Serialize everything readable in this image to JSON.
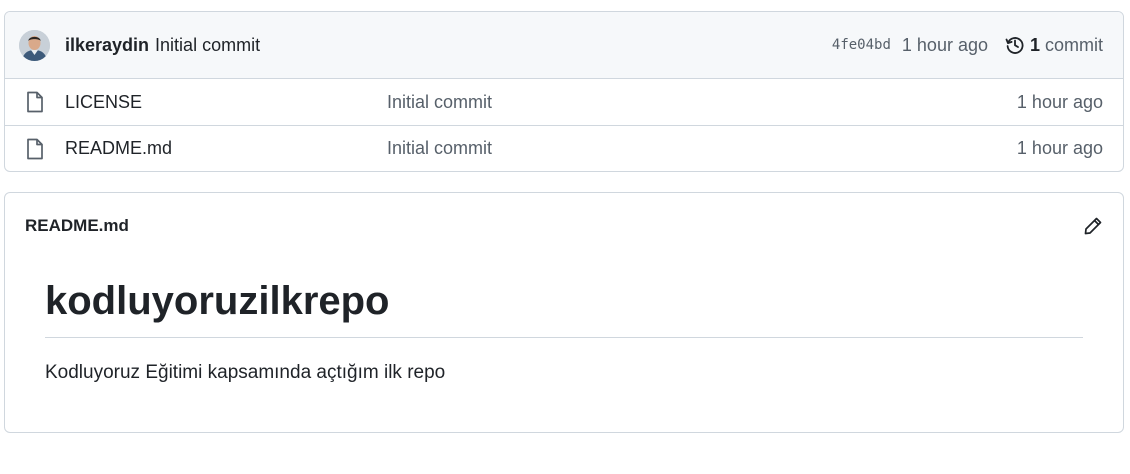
{
  "latest_commit": {
    "author": "ilkeraydin",
    "message": "Initial commit",
    "sha": "4fe04bd",
    "time": "1 hour ago",
    "commit_count": "1",
    "commit_word": "commit"
  },
  "files": [
    {
      "name": "LICENSE",
      "message": "Initial commit",
      "time": "1 hour ago",
      "icon": "file-icon"
    },
    {
      "name": "README.md",
      "message": "Initial commit",
      "time": "1 hour ago",
      "icon": "file-icon"
    }
  ],
  "readme": {
    "filename": "README.md",
    "heading": "kodluyoruzilkrepo",
    "paragraph": "Kodluyoruz Eğitimi kapsamında açtığım ilk repo",
    "edit_icon": "pencil-icon"
  },
  "colors": {
    "text": "#1f2328",
    "muted": "#57606a",
    "border": "#d0d7de",
    "header_bg": "#f6f8fa"
  }
}
